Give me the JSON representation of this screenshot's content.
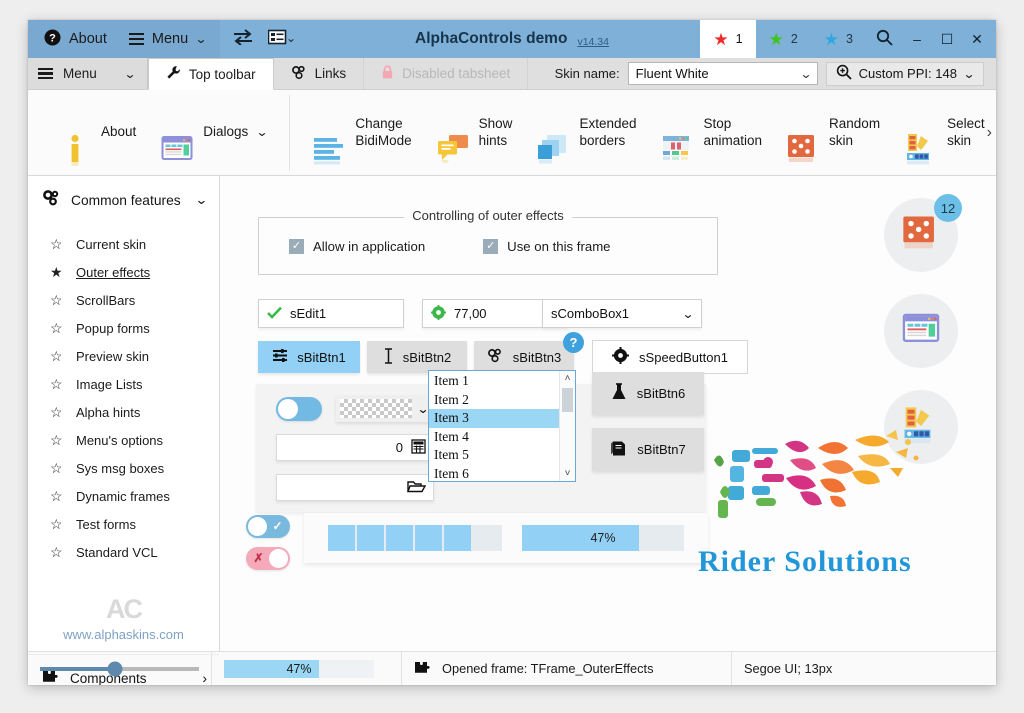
{
  "titlebar": {
    "about_label": "About",
    "menu_label": "Menu",
    "app_title": "AlphaControls demo",
    "version": "v14.34",
    "swap_icon": "swap-arrows-icon",
    "list_icon": "list-dropdown-icon",
    "star_tabs": [
      {
        "label": "1",
        "icon": "star-icon",
        "color": "#ef2b2b",
        "active": true
      },
      {
        "label": "2",
        "icon": "star-icon",
        "color": "#3fc41c",
        "active": false
      },
      {
        "label": "3",
        "icon": "star-icon",
        "color": "#2fa8e0",
        "active": false
      }
    ],
    "search_icon": "search-icon",
    "minimize_label": "–",
    "maximize_label": "☐",
    "close_label": "✕"
  },
  "tabrow": {
    "menu_label": "Menu",
    "tabs": [
      {
        "label": "Top toolbar",
        "icon": "wrench-icon",
        "active": true,
        "disabled": false
      },
      {
        "label": "Links",
        "icon": "chain-links-icon",
        "active": false,
        "disabled": false
      },
      {
        "label": "Disabled tabsheet",
        "icon": "lock-icon",
        "active": false,
        "disabled": true
      }
    ],
    "skin_name_label": "Skin name:",
    "skin_name_value": "Fluent White",
    "ppi_label": "Custom PPI: 148",
    "ppi_icon": "zoom-in-icon"
  },
  "ribbon": {
    "items": [
      {
        "label": "About",
        "icon": "info-pillar-icon"
      },
      {
        "label": "Dialogs",
        "icon": "dialog-window-icon",
        "has_chevron": true
      },
      {
        "label": "Change\nBidiMode",
        "icon": "bidi-lines-icon"
      },
      {
        "label": "Show\nhints",
        "icon": "speech-bubble-icon"
      },
      {
        "label": "Extended\nborders",
        "icon": "layers-icon"
      },
      {
        "label": "Stop\nanimation",
        "icon": "pause-window-icon"
      },
      {
        "label": "Random\nskin",
        "icon": "dice-icon"
      },
      {
        "label": "Select\nskin",
        "icon": "palette-icon"
      }
    ],
    "overflow_label": "›"
  },
  "sidebar": {
    "header": {
      "label": "Common features",
      "icon": "gears-icon",
      "chevron": "chevron-down-icon"
    },
    "items": [
      {
        "label": "Current skin",
        "active": false
      },
      {
        "label": "Outer effects",
        "active": true
      },
      {
        "label": "ScrollBars",
        "active": false
      },
      {
        "label": "Popup forms",
        "active": false
      },
      {
        "label": "Preview skin",
        "active": false
      },
      {
        "label": "Image Lists",
        "active": false
      },
      {
        "label": "Alpha hints",
        "active": false
      },
      {
        "label": "Menu's options",
        "active": false
      },
      {
        "label": "Sys msg boxes",
        "active": false
      },
      {
        "label": "Dynamic frames",
        "active": false
      },
      {
        "label": "Test forms",
        "active": false
      },
      {
        "label": "Standard VCL",
        "active": false
      }
    ],
    "logo_mark": "AC",
    "url": "www.alphaskins.com",
    "footer": {
      "label": "Components",
      "icon": "puzzle-icon",
      "chevron": "chevron-right-icon"
    }
  },
  "content": {
    "groupbox": {
      "title": "Controlling of outer effects",
      "checkboxes": [
        {
          "label": "Allow in application",
          "checked": true
        },
        {
          "label": "Use on this frame",
          "checked": true
        }
      ]
    },
    "edit1": {
      "value": "sEdit1",
      "icon": "green-check-icon"
    },
    "spin1": {
      "value": "77,00",
      "icon": "green-gear-icon"
    },
    "combo1": {
      "value": "sComboBox1",
      "chevron": "chevron-down-icon"
    },
    "bitbuttons": [
      {
        "label": "sBitBtn1",
        "icon": "sliders-icon",
        "selected": true
      },
      {
        "label": "sBitBtn2",
        "icon": "text-cursor-icon",
        "selected": false
      },
      {
        "label": "sBitBtn3",
        "icon": "chain-links-icon",
        "selected": false
      }
    ],
    "help_badge": "?",
    "speedbutton": {
      "label": "sSpeedButton1",
      "icon": "gear-icon"
    },
    "toggle_main": {
      "state": "on"
    },
    "checker_dropdown": {
      "icon": "checkerboard-pattern",
      "chevron": "chevron-down-icon"
    },
    "numeric_edit": {
      "value": "0",
      "icon": "calculator-icon"
    },
    "file_edit": {
      "value": "",
      "icon": "open-folder-icon"
    },
    "listbox": {
      "items": [
        "Item 1",
        "Item 2",
        "Item 3",
        "Item 4",
        "Item 5",
        "Item 6"
      ],
      "selected_index": 2,
      "scroll_up": "˄",
      "scroll_down": "˅"
    },
    "right_buttons": [
      {
        "label": "sBitBtn6",
        "icon": "flask-icon"
      },
      {
        "label": "sBitBtn7",
        "icon": "book-icon"
      }
    ],
    "toggle_check": {
      "icon": "check-icon",
      "state": "on"
    },
    "toggle_cross": {
      "icon": "cross-icon",
      "state": "off"
    },
    "segmented_progress": {
      "segments_filled": 5,
      "segments_total": 11
    },
    "progress": {
      "value": 47,
      "label": "47%"
    },
    "effect_circles": [
      {
        "icon": "dice-icon",
        "badge": "12"
      },
      {
        "icon": "dialog-window-icon",
        "badge": null
      },
      {
        "icon": "palette-icon",
        "badge": null
      }
    ],
    "watermark": {
      "text": "Rider Solutions"
    }
  },
  "statusbar": {
    "slider_value": 47,
    "progress_label": "47%",
    "progress_value": 47,
    "frame_icon": "puzzle-icon",
    "frame_text": "Opened frame: TFrame_OuterEffects",
    "font_text": "Segoe UI; 13px"
  }
}
